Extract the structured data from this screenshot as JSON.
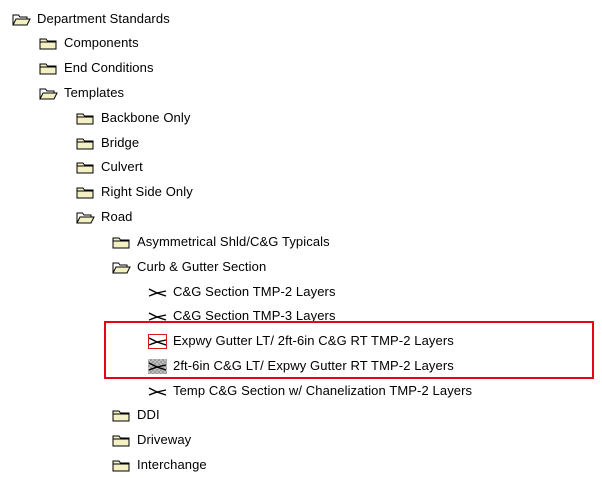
{
  "tree": {
    "items": [
      {
        "id": "department-standards",
        "label": "Department Standards",
        "icon": "folder-open-icon"
      },
      {
        "id": "components",
        "label": "Components",
        "icon": "folder-icon"
      },
      {
        "id": "end-conditions",
        "label": "End Conditions",
        "icon": "folder-icon"
      },
      {
        "id": "templates",
        "label": "Templates",
        "icon": "folder-open-icon"
      },
      {
        "id": "backbone-only",
        "label": "Backbone Only",
        "icon": "folder-icon"
      },
      {
        "id": "bridge",
        "label": "Bridge",
        "icon": "folder-icon"
      },
      {
        "id": "culvert",
        "label": "Culvert",
        "icon": "folder-icon"
      },
      {
        "id": "right-side-only",
        "label": "Right Side Only",
        "icon": "folder-icon"
      },
      {
        "id": "road",
        "label": "Road",
        "icon": "folder-open-icon"
      },
      {
        "id": "asymmetrical-shld",
        "label": "Asymmetrical Shld/C&G Typicals",
        "icon": "folder-icon"
      },
      {
        "id": "curb-gutter-section",
        "label": "Curb & Gutter Section",
        "icon": "folder-open-icon"
      },
      {
        "id": "cg-section-tmp2",
        "label": "C&G Section TMP-2 Layers",
        "icon": "template-icon"
      },
      {
        "id": "cg-section-tmp3",
        "label": "C&G Section TMP-3 Layers",
        "icon": "template-icon"
      },
      {
        "id": "expwy-gutter-lt",
        "label": "Expwy Gutter LT/ 2ft-6in C&G RT TMP-2 Layers",
        "icon": "template-icon"
      },
      {
        "id": "2ft6in-cg-lt",
        "label": "2ft-6in C&G LT/  Expwy Gutter RT TMP-2 Layers",
        "icon": "template-icon"
      },
      {
        "id": "temp-cg-section",
        "label": "Temp C&G Section w/ Chanelization TMP-2 Layers",
        "icon": "template-icon"
      },
      {
        "id": "ddi",
        "label": "DDI",
        "icon": "folder-icon"
      },
      {
        "id": "driveway",
        "label": "Driveway",
        "icon": "folder-icon"
      },
      {
        "id": "interchange",
        "label": "Interchange",
        "icon": "folder-icon"
      }
    ]
  },
  "colors": {
    "folder_fill": "#f3f0c4",
    "folder_stroke": "#000000",
    "template_stroke": "#000000",
    "highlight_border": "#e30613"
  }
}
